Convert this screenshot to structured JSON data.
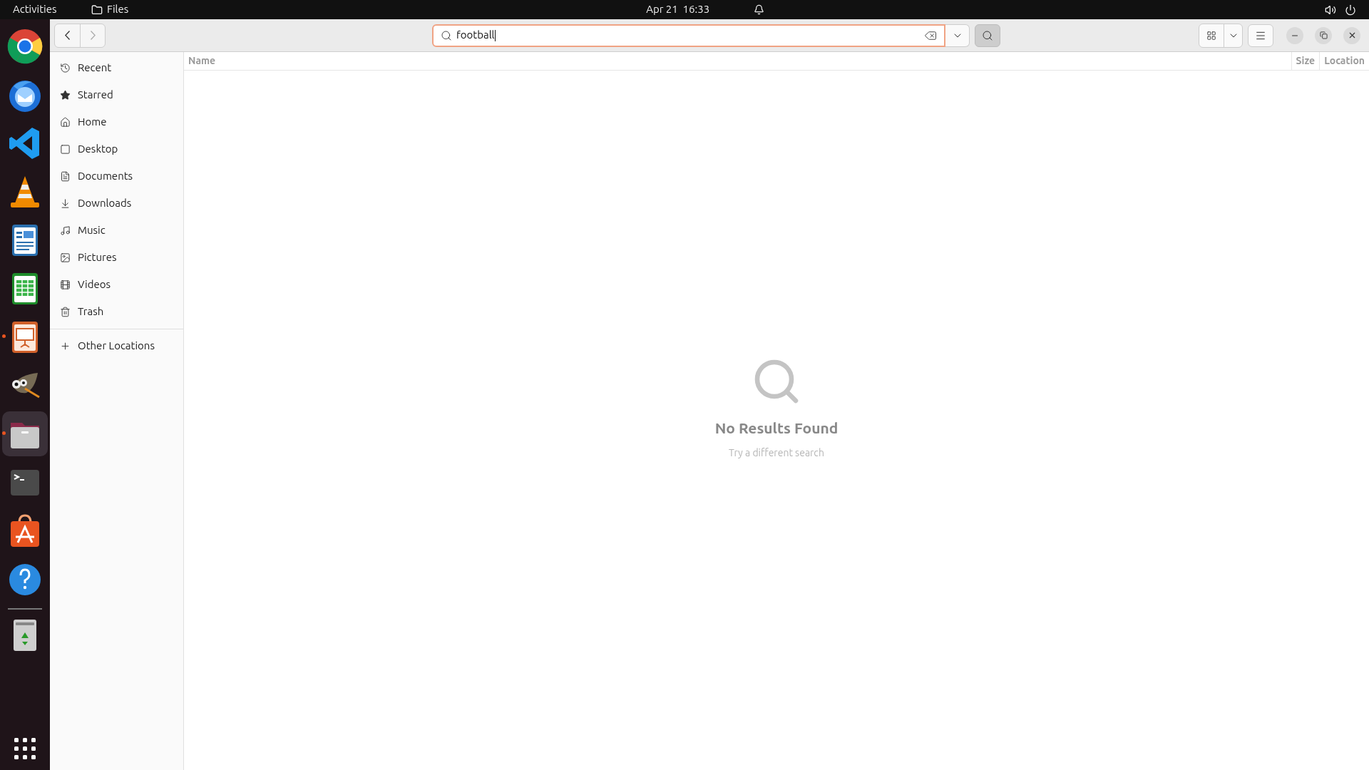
{
  "top_bar": {
    "activities": "Activities",
    "app_name": "Files",
    "clock": "Apr 21  16:33"
  },
  "dock": {
    "items": [
      {
        "kind": "chrome",
        "running": false,
        "selected": false
      },
      {
        "kind": "thunderbird",
        "running": false,
        "selected": false
      },
      {
        "kind": "vscode",
        "running": false,
        "selected": false
      },
      {
        "kind": "vlc",
        "running": false,
        "selected": false
      },
      {
        "kind": "writer",
        "running": false,
        "selected": false
      },
      {
        "kind": "calc",
        "running": false,
        "selected": false
      },
      {
        "kind": "impress",
        "running": true,
        "selected": false
      },
      {
        "kind": "gimp",
        "running": false,
        "selected": false
      },
      {
        "kind": "files",
        "running": true,
        "selected": true
      },
      {
        "kind": "terminal",
        "running": false,
        "selected": false
      },
      {
        "kind": "store",
        "running": false,
        "selected": false
      },
      {
        "kind": "help",
        "running": false,
        "selected": false
      },
      {
        "kind": "trash",
        "running": false,
        "selected": false
      }
    ]
  },
  "toolbar": {
    "search": {
      "value": "football"
    },
    "search_toggle": {
      "selected": true
    }
  },
  "sidebar": {
    "items": [
      {
        "kind": "recent",
        "label": "Recent",
        "selected": false
      },
      {
        "kind": "starred",
        "label": "Starred",
        "selected": false
      },
      {
        "kind": "home",
        "label": "Home",
        "selected": false
      },
      {
        "kind": "desktop",
        "label": "Desktop",
        "selected": false
      },
      {
        "kind": "documents",
        "label": "Documents",
        "selected": false
      },
      {
        "kind": "downloads",
        "label": "Downloads",
        "selected": false
      },
      {
        "kind": "music",
        "label": "Music",
        "selected": false
      },
      {
        "kind": "pictures",
        "label": "Pictures",
        "selected": false
      },
      {
        "kind": "videos",
        "label": "Videos",
        "selected": false
      },
      {
        "kind": "trash",
        "label": "Trash",
        "selected": false
      }
    ],
    "other": {
      "label": "Other Locations"
    }
  },
  "table": {
    "columns": [
      "Name",
      "Size",
      "Location"
    ]
  },
  "empty_state": {
    "title": "No Results Found",
    "subtitle": "Try a different search"
  }
}
